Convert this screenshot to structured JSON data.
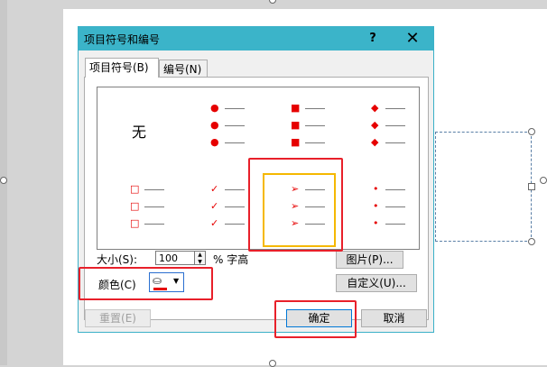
{
  "dialog": {
    "title": "项目符号和编号",
    "help_label": "?",
    "close_label": "✕"
  },
  "tabs": [
    {
      "label": "项目符号(B)",
      "active": true
    },
    {
      "label": "编号(N)",
      "active": false
    }
  ],
  "gallery": {
    "none_label": "无",
    "styles": [
      {
        "symbol": "●",
        "name": "filled-circle"
      },
      {
        "symbol": "■",
        "name": "filled-square"
      },
      {
        "symbol": "◆",
        "name": "filled-diamond"
      },
      {
        "symbol": "□",
        "name": "hollow-square"
      },
      {
        "symbol": "✓",
        "name": "checkmark"
      },
      {
        "symbol": "➢",
        "name": "arrow"
      },
      {
        "symbol": "•",
        "name": "small-dot"
      }
    ],
    "selected": "arrow",
    "bullet_color": "#e60000",
    "selection_color": "#f5b800"
  },
  "size": {
    "label": "大小(S):",
    "value": "100",
    "unit_label": "% 字高"
  },
  "color": {
    "label": "颜色(C)",
    "value": "#e60000"
  },
  "buttons": {
    "picture": "图片(P)...",
    "customize": "自定义(U)...",
    "reset": "重置(E)",
    "ok": "确定",
    "cancel": "取消"
  },
  "annotation_color": "#e8202a"
}
